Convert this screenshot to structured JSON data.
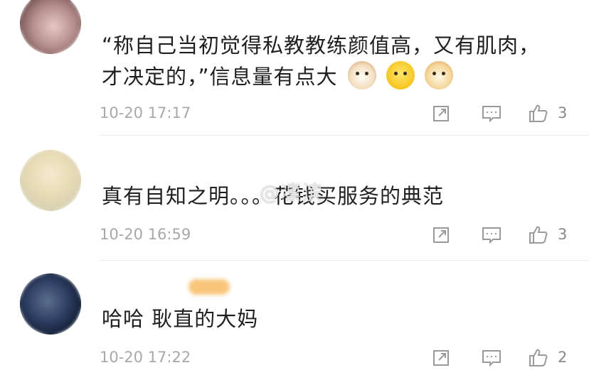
{
  "comments": [
    {
      "text": "“称自己当初觉得私教教练颜值高，又有肌肉，才决定的，”信息量有点大",
      "emojis": [
        "cat-icon",
        "smiling-face-icon",
        "doge-icon"
      ],
      "time": "10-20 17:17",
      "likes": "3"
    },
    {
      "text": "真有自知之明。。。花钱买服务的典范",
      "time": "10-20 16:59",
      "likes": "3"
    },
    {
      "text": "哈哈 耿直的大妈",
      "time": "10-20 17:22",
      "likes": "2"
    }
  ],
  "watermark": "@凛滨",
  "icons": {
    "repost": "repost-icon",
    "comment": "comment-icon",
    "like": "thumbs-up-icon"
  },
  "colors": {
    "text": "#1f1f1f",
    "meta": "#a8a8a8",
    "icon": "#9a9a9a",
    "divider": "#e9e9e9"
  }
}
